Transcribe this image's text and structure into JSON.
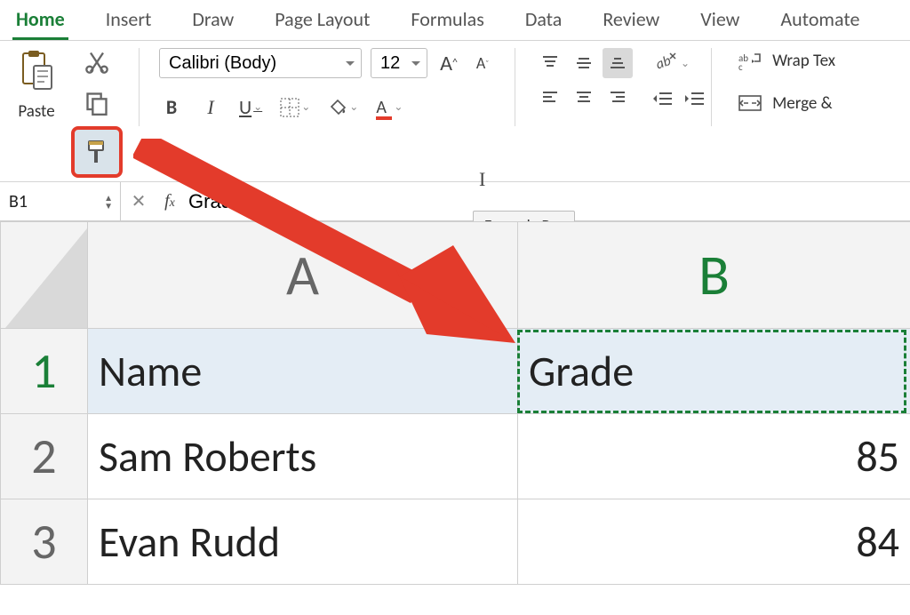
{
  "tabs": [
    "Home",
    "Insert",
    "Draw",
    "Page Layout",
    "Formulas",
    "Data",
    "Review",
    "View",
    "Automate"
  ],
  "active_tab_index": 0,
  "clipboard": {
    "paste_label": "Paste"
  },
  "font": {
    "family": "Calibri (Body)",
    "size": "12",
    "bold": "B",
    "italic": "I",
    "underline": "U"
  },
  "wrap_label": "Wrap Tex",
  "merge_label": "Merge &",
  "namebox": "B1",
  "formula_value": "Grade",
  "tooltip": "Formula Bar",
  "columns": [
    "A",
    "B"
  ],
  "active_column_index": 1,
  "rows": [
    {
      "n": "1",
      "a": "Name",
      "b": "Grade",
      "b_align": "l",
      "hdr": true
    },
    {
      "n": "2",
      "a": "Sam Roberts",
      "b": "85",
      "b_align": "r",
      "hdr": false
    },
    {
      "n": "3",
      "a": "Evan Rudd",
      "b": "84",
      "b_align": "r",
      "hdr": false
    }
  ],
  "colors": {
    "accent": "#1a7f37",
    "annotation": "#e33b2b"
  }
}
